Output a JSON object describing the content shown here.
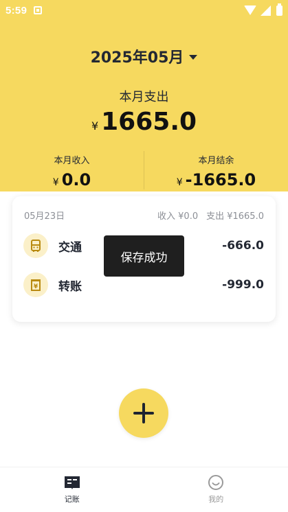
{
  "status_bar": {
    "time": "5:59"
  },
  "header": {
    "month": "2025年05月",
    "expense_label": "本月支出",
    "currency": "¥",
    "expense_total": "1665.0",
    "income_label": "本月收入",
    "income_value": "0.0",
    "balance_label": "本月结余",
    "balance_value": "-1665.0"
  },
  "day_card": {
    "date": "05月23日",
    "income_summary": "收入 ¥0.0",
    "expense_summary": "支出 ¥1665.0",
    "records": [
      {
        "icon": "bus-icon",
        "category": "交通",
        "amount": "-666.0"
      },
      {
        "icon": "transfer-icon",
        "category": "转账",
        "amount": "-999.0"
      }
    ]
  },
  "toast": {
    "message": "保存成功"
  },
  "bottom_nav": {
    "items": [
      {
        "label": "记账",
        "icon": "ledger-icon",
        "active": true
      },
      {
        "label": "我的",
        "icon": "smile-icon",
        "active": false
      }
    ]
  },
  "colors": {
    "accent": "#f6d95f",
    "icon_bg": "#fbf0c9",
    "text_dark": "#232833"
  }
}
